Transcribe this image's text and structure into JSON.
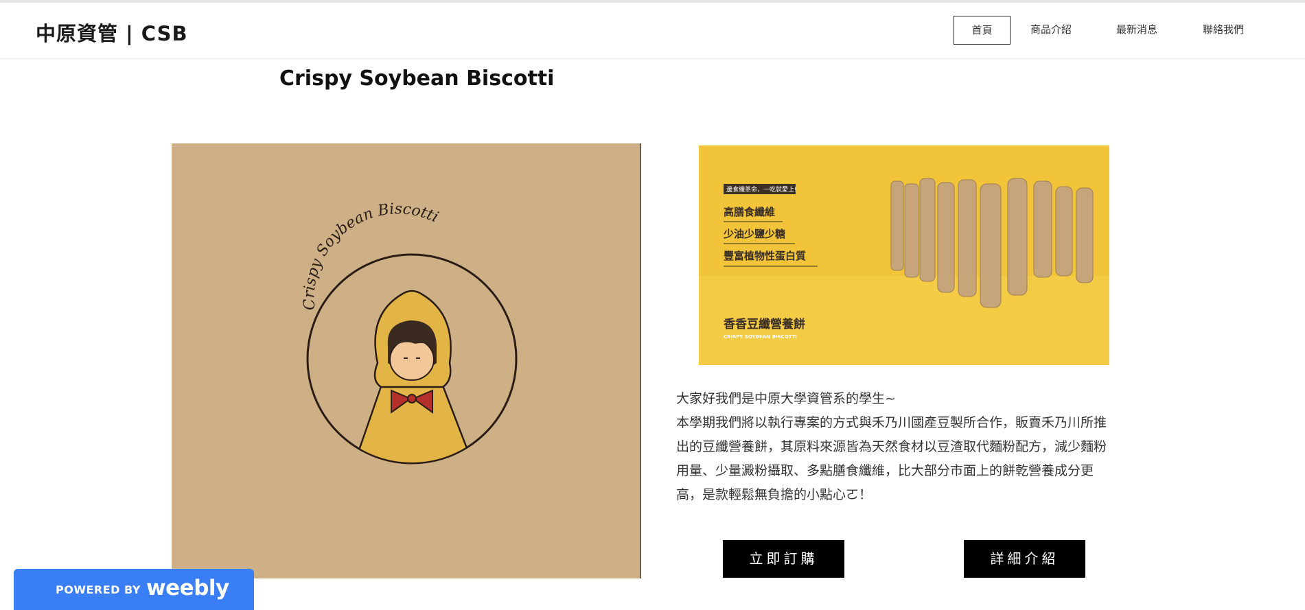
{
  "site": {
    "title": "中原資管 | CSB"
  },
  "nav": {
    "items": [
      {
        "label": "首頁",
        "active": true
      },
      {
        "label": "商品介紹",
        "active": false
      },
      {
        "label": "最新消息",
        "active": false
      },
      {
        "label": "聯絡我們",
        "active": false
      }
    ]
  },
  "main": {
    "heading": "Crispy Soybean Biscotti",
    "logo_image": {
      "ring_text": "Crispy Soybean Biscotti"
    },
    "promo_image": {
      "tag": "邊食纖革命，一吃就愛上!",
      "features": [
        "高膳食纖維",
        "少油少鹽少糖",
        "豐富植物性蛋白質"
      ],
      "product_name": "香香豆纖營養餅",
      "product_name_en": "CRISPY SOYBEAN BISCOTTI"
    },
    "intro_lines": [
      "大家好我們是中原大學資管系的學生~",
      "本學期我們將以執行專案的方式與禾乃川國產豆製所合作，販賣禾乃川所推",
      "出的豆纖營養餅，其原料來源皆為天然食材以豆渣取代麵粉配方，減少麵粉",
      "用量、少量澱粉攝取、多點膳食纖維，比大部分市面上的餅乾營養成分更",
      "高，是款輕鬆無負擔的小點心ㄛ！"
    ],
    "buttons": {
      "order": "立即訂購",
      "details": "詳細介紹"
    }
  },
  "badge": {
    "powered_by": "POWERED BY",
    "brand": "weebly"
  },
  "colors": {
    "accent_yellow": "#f2c43a",
    "logo_bg": "#cdb086",
    "button": "#000000",
    "weebly_blue": "#3a7ef5"
  }
}
